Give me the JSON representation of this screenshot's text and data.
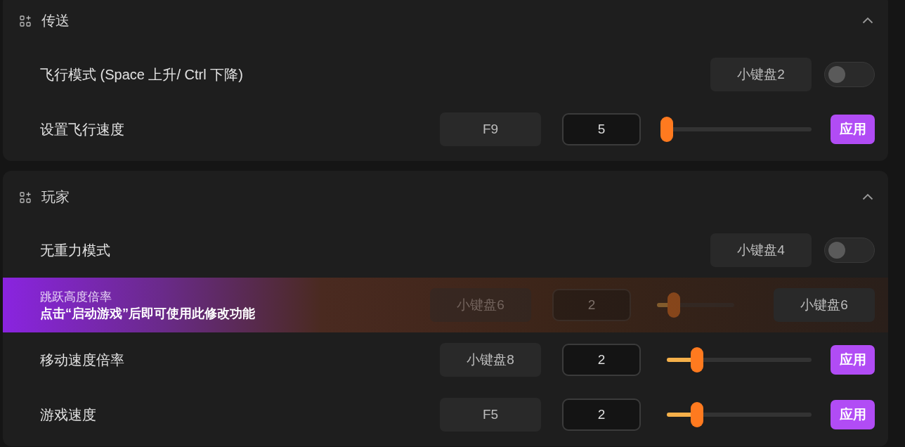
{
  "sections": [
    {
      "title": "传送",
      "expanded": true,
      "rows": [
        {
          "kind": "toggle",
          "label": "飞行模式 (Space 上升/ Ctrl 下降)",
          "hotkey": "小键盘2",
          "on": false
        },
        {
          "kind": "slider",
          "label": "设置飞行速度",
          "hotkey": "F9",
          "value": "5",
          "level": 0,
          "button": "应用"
        }
      ]
    },
    {
      "title": "玩家",
      "expanded": true,
      "rows": [
        {
          "kind": "toggle",
          "label": "无重力模式",
          "hotkey": "小键盘4",
          "on": false
        },
        {
          "kind": "locked",
          "label": "跳跃高度倍率",
          "hint": "点击“启动游戏”后即可使用此修改功能",
          "hotkey": "小键盘6",
          "value": "2",
          "level": 0.19,
          "button": "小键盘6"
        },
        {
          "kind": "slider",
          "label": "移动速度倍率",
          "hotkey": "小键盘8",
          "value": "2",
          "level": 0.19,
          "button": "应用"
        },
        {
          "kind": "slider",
          "label": "游戏速度",
          "hotkey": "F5",
          "value": "2",
          "level": 0.19,
          "button": "应用"
        }
      ]
    }
  ]
}
